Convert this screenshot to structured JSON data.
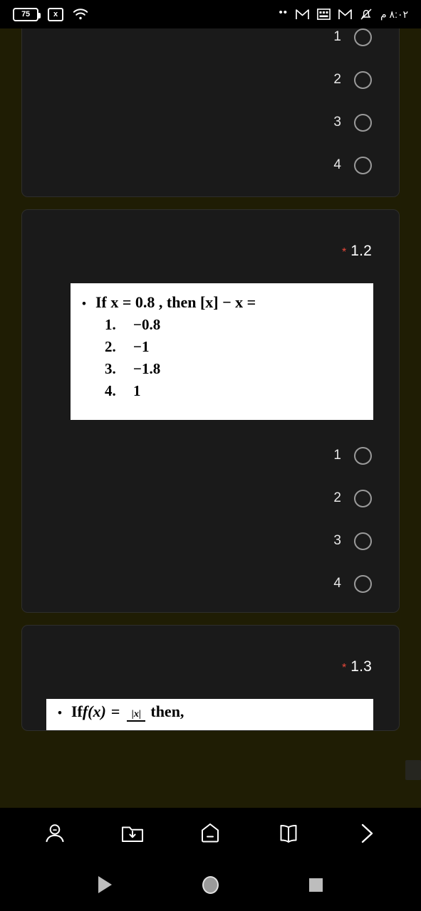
{
  "status_bar": {
    "battery_level": "75",
    "sim_icon": "x",
    "wifi_icon": "wifi-icon",
    "overflow_icon": "more-dots-icon",
    "gmail_icon_1": "gmail-icon",
    "keyboard_icon": "keyboard-icon",
    "gmail_icon_2": "gmail-icon",
    "mute_icon": "notifications-muted-icon",
    "time": "٨:٠٢ م"
  },
  "form": {
    "questions": [
      {
        "number": "",
        "required_marker": "",
        "image_alt": "question-image-cropped",
        "options": [
          {
            "label": "1",
            "selected": false
          },
          {
            "label": "2",
            "selected": false
          },
          {
            "label": "3",
            "selected": false
          },
          {
            "label": "4",
            "selected": false
          }
        ]
      },
      {
        "number": "1.2",
        "required_marker": "*",
        "image_alt": "question-image-math",
        "math": {
          "bullet": "•",
          "stem_parts": [
            "If ",
            "x",
            " = 0.8 , then [",
            "x",
            "] − ",
            "x",
            " ="
          ],
          "stem_plain": "If x = 0.8 , then [x] − x =",
          "choices": [
            {
              "index": "1.",
              "value": "−0.8"
            },
            {
              "index": "2.",
              "value": "−1"
            },
            {
              "index": "3.",
              "value": "−1.8"
            },
            {
              "index": "4.",
              "value": "1"
            }
          ]
        },
        "options": [
          {
            "label": "1",
            "selected": false
          },
          {
            "label": "2",
            "selected": false
          },
          {
            "label": "3",
            "selected": false
          },
          {
            "label": "4",
            "selected": false
          }
        ]
      },
      {
        "number": "1.3",
        "required_marker": "*",
        "image_alt": "question-image-math-partial",
        "math": {
          "bullet": "•",
          "stem_prefix": "If ",
          "fn": "f",
          "arg": "(x)",
          "equals": "=",
          "frac_numerator": "|x|",
          "stem_suffix": "then,"
        }
      }
    ]
  },
  "browser_bar": {
    "buttons": [
      {
        "name": "profile-icon",
        "label": "Profile"
      },
      {
        "name": "downloads-icon",
        "label": "Downloads"
      },
      {
        "name": "home-icon",
        "label": "Home"
      },
      {
        "name": "bookmarks-icon",
        "label": "Bookmarks"
      },
      {
        "name": "forward-icon",
        "label": "Forward"
      }
    ]
  },
  "android_nav": {
    "back_label": "Back",
    "home_label": "Home",
    "recents_label": "Recents"
  },
  "colors": {
    "page_background": "#1f1d04",
    "card_background": "#1a1a1a",
    "required_red": "#e8483a",
    "text_white": "#ffffff"
  }
}
